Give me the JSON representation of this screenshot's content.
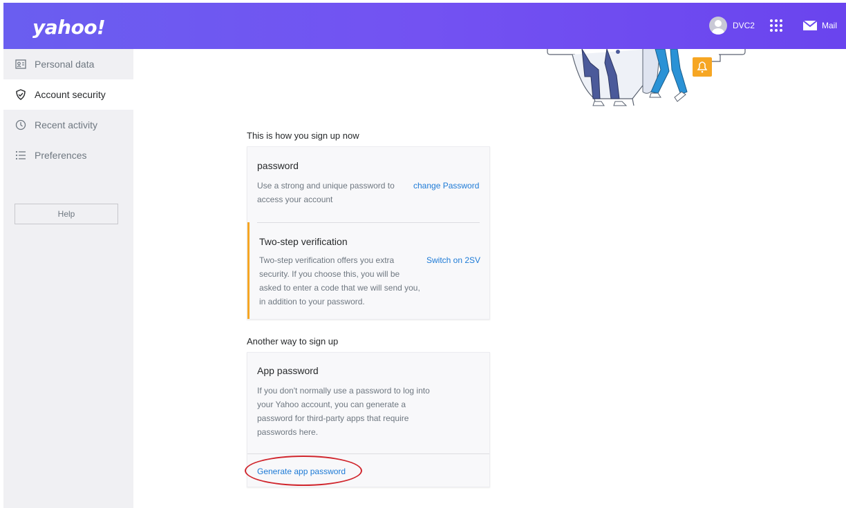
{
  "header": {
    "logo": "yahoo!",
    "username": "DVC2",
    "mail_label": "Mail",
    "icons": [
      "avatar-icon",
      "apps-grid-icon",
      "mail-icon"
    ]
  },
  "sidebar": {
    "items": [
      {
        "label": "Personal data",
        "icon": "id-card-icon",
        "active": false
      },
      {
        "label": "Account security",
        "icon": "shield-check-icon",
        "active": true
      },
      {
        "label": "Recent activity",
        "icon": "clock-icon",
        "active": false
      },
      {
        "label": "Preferences",
        "icon": "list-icon",
        "active": false
      }
    ],
    "help_label": "Help"
  },
  "main": {
    "signin_title": "This is how you sign up now",
    "password": {
      "title": "password",
      "desc_line1": "Use a strong and unique password to",
      "desc_line2": "access your account",
      "link": "change Password"
    },
    "two_step": {
      "title": "Two-step verification",
      "desc_line1": "Two-step verification offers you extra",
      "desc_line2": "security. If you choose this, you will be",
      "desc_line3": "asked to enter a code that we will send you,",
      "desc_line4": "in addition to your password.",
      "link": "Switch on 2SV"
    },
    "other_title": "Another way to sign up",
    "app_password": {
      "title": "App password",
      "desc_line1": "If you don't normally use a password to log into",
      "desc_line2": "your Yahoo account, you can generate a",
      "desc_line3": "password for third-party apps that require",
      "desc_line4": "passwords here.",
      "link": "Generate app password"
    }
  },
  "colors": {
    "header_gradient": "#6a5ef0",
    "link": "#1d7ad6",
    "accent_bar": "#f6a623",
    "highlight_ellipse": "#d0252c",
    "sidebar_bg": "#f0f0f3"
  }
}
